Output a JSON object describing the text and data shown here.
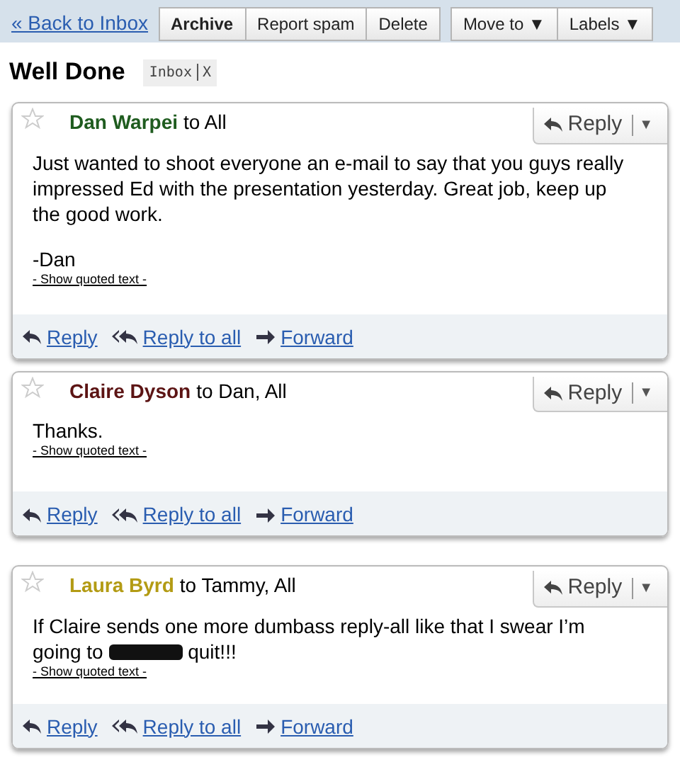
{
  "toolbar": {
    "back_link": "« Back to Inbox",
    "groups": [
      [
        {
          "label": "Archive",
          "bold": true
        },
        {
          "label": "Report spam",
          "bold": false
        },
        {
          "label": "Delete",
          "bold": false
        }
      ],
      [
        {
          "label": "Move to ▼",
          "bold": false
        },
        {
          "label": "Labels ▼",
          "bold": false
        }
      ]
    ]
  },
  "thread": {
    "subject": "Well Done",
    "labels": [
      {
        "name": "Inbox",
        "remove": "X"
      }
    ]
  },
  "messages": [
    {
      "sender": "Dan Warpei",
      "color": "#1f5c1f",
      "recipients": "to All",
      "starred": false,
      "reply_button": "Reply",
      "menu_caret": "▼",
      "body": [
        [
          {
            "kind": "text",
            "text": "Just wanted to shoot everyone an e-mail to say that you guys really impressed Ed with the presentation yesterday.  Great job, keep up the good work."
          }
        ],
        [
          {
            "kind": "text",
            "text": "-Dan"
          }
        ]
      ],
      "quoted_link": "- Show quoted text -",
      "actions": [
        {
          "kind": "reply",
          "label": "Reply"
        },
        {
          "kind": "reply_all",
          "label": "Reply to all"
        },
        {
          "kind": "forward",
          "label": "Forward"
        }
      ]
    },
    {
      "sender": "Claire Dyson",
      "color": "#5c1414",
      "recipients": "to Dan, All",
      "starred": false,
      "reply_button": "Reply",
      "menu_caret": "▼",
      "body": [
        [
          {
            "kind": "text",
            "text": "Thanks."
          }
        ]
      ],
      "quoted_link": "- Show quoted text -",
      "actions": [
        {
          "kind": "reply",
          "label": "Reply"
        },
        {
          "kind": "reply_all",
          "label": "Reply to all"
        },
        {
          "kind": "forward",
          "label": "Forward"
        }
      ]
    },
    {
      "sender": "Laura Byrd",
      "color": "#b39b14",
      "recipients": "to Tammy, All",
      "starred": false,
      "reply_button": "Reply",
      "menu_caret": "▼",
      "body": [
        [
          {
            "kind": "text",
            "text": "If Claire sends one more dumbass reply-all like that I swear I’m going to "
          },
          {
            "kind": "redacted"
          },
          {
            "kind": "text",
            "text": " quit!!!"
          }
        ]
      ],
      "quoted_link": "- Show quoted text -",
      "actions": [
        {
          "kind": "reply",
          "label": "Reply"
        },
        {
          "kind": "reply_all",
          "label": "Reply to all"
        },
        {
          "kind": "forward",
          "label": "Forward"
        }
      ]
    }
  ]
}
